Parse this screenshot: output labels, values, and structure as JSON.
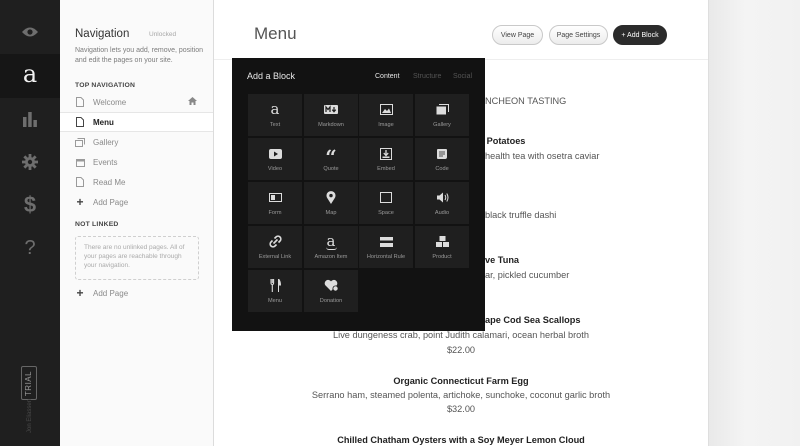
{
  "rail": {
    "items": [
      {
        "icon": "eye-icon"
      },
      {
        "icon": "logo-a-icon",
        "glyph": "a"
      },
      {
        "icon": "bar-chart-icon"
      },
      {
        "icon": "gear-icon"
      },
      {
        "icon": "dollar-icon",
        "glyph": "$"
      },
      {
        "icon": "help-icon",
        "glyph": "?"
      }
    ],
    "trial_label": "TRIAL",
    "user_label": "Jon Eliassen"
  },
  "navigation": {
    "title": "Navigation",
    "status": "Unlocked",
    "description": "Navigation lets you add, remove, position and edit the pages on your site.",
    "top_heading": "TOP NAVIGATION",
    "top_items": [
      {
        "label": "Welcome",
        "icon": "page-icon",
        "home": true
      },
      {
        "label": "Menu",
        "icon": "page-icon",
        "active": true
      },
      {
        "label": "Gallery",
        "icon": "gallery-icon"
      },
      {
        "label": "Events",
        "icon": "events-icon"
      },
      {
        "label": "Read Me",
        "icon": "page-icon"
      },
      {
        "label": "Add Page",
        "icon": "plus-icon"
      }
    ],
    "not_linked_heading": "NOT LINKED",
    "not_linked_empty": "There are no unlinked pages. All of your pages are reachable through your navigation.",
    "not_linked_add": "Add Page"
  },
  "page": {
    "title": "Menu",
    "buttons": {
      "view": "View Page",
      "settings": "Page Settings",
      "add_block": "+ Add Block"
    },
    "visible_fragments": {
      "tasting": "NCHEON TASTING",
      "potatoes": ") Potatoes",
      "caviar": "health tea with osetra caviar",
      "dashi": "black truffle dashi",
      "tuna": "ve Tuna",
      "cucumber": "ar, pickled cucumber",
      "scallops": "ape Cod Sea Scallops"
    },
    "items": [
      {
        "description": "Live dungeness crab, point Judith calamari, ocean herbal broth",
        "price": "$22.00"
      },
      {
        "name": "Organic Connecticut Farm Egg",
        "description": "Serrano ham, steamed polenta, artichoke, sunchoke, coconut garlic broth",
        "price": "$32.00"
      },
      {
        "name": "Chilled Chatham Oysters with a Soy Meyer Lemon Cloud"
      }
    ]
  },
  "add_block": {
    "title": "Add a Block",
    "tabs": [
      "Content",
      "Structure",
      "Social"
    ],
    "active_tab": "Content",
    "blocks": [
      {
        "label": "Text",
        "icon": "text-icon"
      },
      {
        "label": "Markdown",
        "icon": "markdown-icon"
      },
      {
        "label": "Image",
        "icon": "image-icon"
      },
      {
        "label": "Gallery",
        "icon": "gallery-icon"
      },
      {
        "label": "Video",
        "icon": "video-icon"
      },
      {
        "label": "Quote",
        "icon": "quote-icon"
      },
      {
        "label": "Embed",
        "icon": "embed-icon"
      },
      {
        "label": "Code",
        "icon": "code-icon"
      },
      {
        "label": "Form",
        "icon": "form-icon"
      },
      {
        "label": "Map",
        "icon": "map-pin-icon"
      },
      {
        "label": "Space",
        "icon": "space-icon"
      },
      {
        "label": "Audio",
        "icon": "audio-icon"
      },
      {
        "label": "External Link",
        "icon": "link-icon"
      },
      {
        "label": "Amazon Item",
        "icon": "amazon-icon"
      },
      {
        "label": "Horizontal Rule",
        "icon": "horizontal-rule-icon"
      },
      {
        "label": "Product",
        "icon": "product-icon"
      },
      {
        "label": "Menu",
        "icon": "fork-knife-icon"
      },
      {
        "label": "Donation",
        "icon": "donation-icon"
      }
    ]
  },
  "colors": {
    "rail": "#1f1f1f",
    "overlay": "#121212",
    "tile": "#1f1f1f",
    "primary_button": "#2b2b2b"
  }
}
